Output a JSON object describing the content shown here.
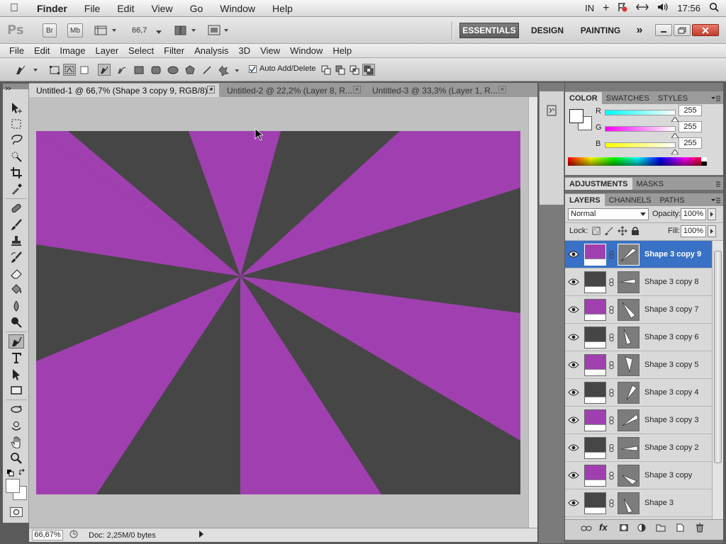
{
  "macbar": {
    "app_name": "Finder",
    "items": [
      "File",
      "Edit",
      "View",
      "Go",
      "Window",
      "Help"
    ],
    "input_source": "IN",
    "clock": "17:56"
  },
  "appbar": {
    "logo": "Ps",
    "bridge": "Br",
    "minibridge": "Mb",
    "zoom": "66,7",
    "workspaces": [
      "ESSENTIALS",
      "DESIGN",
      "PAINTING"
    ],
    "active_workspace": "ESSENTIALS",
    "more": "»"
  },
  "menu": [
    "File",
    "Edit",
    "Image",
    "Layer",
    "Select",
    "Filter",
    "Analysis",
    "3D",
    "View",
    "Window",
    "Help"
  ],
  "options": {
    "auto_add_delete_label": "Auto Add/Delete",
    "auto_add_delete_checked": true
  },
  "tabs": [
    {
      "label": "Untitled-1 @ 66,7% (Shape 3 copy 9, RGB/8) *",
      "active": true
    },
    {
      "label": "Untitled-2 @ 22,2% (Layer 8, R...",
      "active": false
    },
    {
      "label": "Untitled-3 @ 33,3% (Layer 1, R...",
      "active": false
    }
  ],
  "canvas": {
    "colors": {
      "purple": "#a040b0",
      "gray": "#464646",
      "workspace": "#c0c0c0"
    }
  },
  "status": {
    "zoom": "66,67%",
    "doc": "Doc: 2,25M/0 bytes"
  },
  "color_panel": {
    "tabs": [
      "COLOR",
      "SWATCHES",
      "STYLES"
    ],
    "channels": [
      {
        "label": "R",
        "value": "255"
      },
      {
        "label": "G",
        "value": "255"
      },
      {
        "label": "B",
        "value": "255"
      }
    ]
  },
  "adjust_panel": {
    "tabs": [
      "ADJUSTMENTS",
      "MASKS"
    ]
  },
  "layers_panel": {
    "tabs": [
      "LAYERS",
      "CHANNELS",
      "PATHS"
    ],
    "blend_mode": "Normal",
    "opacity_label": "Opacity:",
    "opacity": "100%",
    "lock_label": "Lock:",
    "fill_label": "Fill:",
    "fill": "100%",
    "layers": [
      {
        "name": "Shape 3 copy 9",
        "color": "#a040b0",
        "selected": true
      },
      {
        "name": "Shape 3 copy 8",
        "color": "#464646",
        "selected": false
      },
      {
        "name": "Shape 3 copy 7",
        "color": "#a040b0",
        "selected": false
      },
      {
        "name": "Shape 3 copy 6",
        "color": "#464646",
        "selected": false
      },
      {
        "name": "Shape 3 copy 5",
        "color": "#a040b0",
        "selected": false
      },
      {
        "name": "Shape 3 copy 4",
        "color": "#464646",
        "selected": false
      },
      {
        "name": "Shape 3 copy 3",
        "color": "#a040b0",
        "selected": false
      },
      {
        "name": "Shape 3 copy 2",
        "color": "#464646",
        "selected": false
      },
      {
        "name": "Shape 3 copy",
        "color": "#a040b0",
        "selected": false
      },
      {
        "name": "Shape 3",
        "color": "#464646",
        "selected": false
      }
    ]
  }
}
